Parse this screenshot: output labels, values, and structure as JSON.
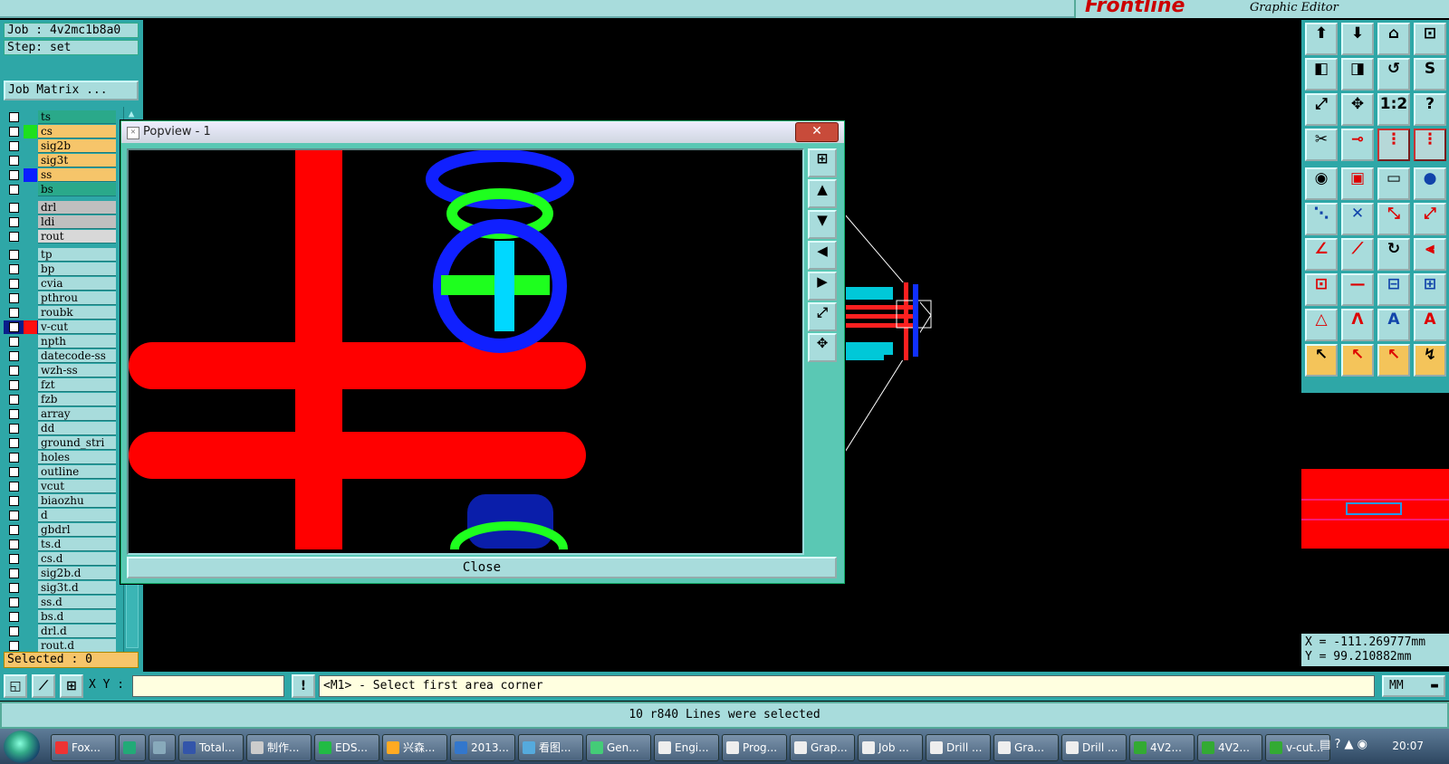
{
  "app": {
    "brand": "Frontline",
    "editor_title": "Graphic Editor"
  },
  "job": {
    "job_label": "Job : 4v2mc1b8a0",
    "step_label": "Step: set",
    "matrix_button": "Job Matrix ..."
  },
  "layers": [
    {
      "name": "ts",
      "bg": "#2aa98a",
      "swatch": ""
    },
    {
      "name": "cs",
      "bg": "#f6c56a",
      "swatch": "#1ee01e"
    },
    {
      "name": "sig2b",
      "bg": "#f6c56a",
      "swatch": ""
    },
    {
      "name": "sig3t",
      "bg": "#f6c56a",
      "swatch": ""
    },
    {
      "name": "ss",
      "bg": "#f6c56a",
      "swatch": "#0a1eff"
    },
    {
      "name": "bs",
      "bg": "#2aa98a",
      "swatch": ""
    },
    {
      "name": "drl",
      "bg": "#bfbfbf",
      "swatch": ""
    },
    {
      "name": "ldi",
      "bg": "#bfbfbf",
      "swatch": ""
    },
    {
      "name": "rout",
      "bg": "#d8d8d8",
      "swatch": ""
    },
    {
      "name": "tp",
      "bg": "#a8dcdc",
      "swatch": ""
    },
    {
      "name": "bp",
      "bg": "#a8dcdc",
      "swatch": ""
    },
    {
      "name": "cvia",
      "bg": "#a8dcdc",
      "swatch": ""
    },
    {
      "name": "pthrou",
      "bg": "#a8dcdc",
      "swatch": ""
    },
    {
      "name": "roubk",
      "bg": "#a8dcdc",
      "swatch": ""
    },
    {
      "name": "v-cut",
      "bg": "#a8dcdc",
      "swatch": "#ff1010",
      "active": true
    },
    {
      "name": "npth",
      "bg": "#a8dcdc",
      "swatch": ""
    },
    {
      "name": "datecode-ss",
      "bg": "#a8dcdc",
      "swatch": ""
    },
    {
      "name": "wzh-ss",
      "bg": "#a8dcdc",
      "swatch": ""
    },
    {
      "name": "fzt",
      "bg": "#a8dcdc",
      "swatch": ""
    },
    {
      "name": "fzb",
      "bg": "#a8dcdc",
      "swatch": ""
    },
    {
      "name": "array",
      "bg": "#a8dcdc",
      "swatch": ""
    },
    {
      "name": "dd",
      "bg": "#a8dcdc",
      "swatch": ""
    },
    {
      "name": "ground_stri",
      "bg": "#a8dcdc",
      "swatch": ""
    },
    {
      "name": "holes",
      "bg": "#a8dcdc",
      "swatch": ""
    },
    {
      "name": "outline",
      "bg": "#a8dcdc",
      "swatch": ""
    },
    {
      "name": "vcut",
      "bg": "#a8dcdc",
      "swatch": ""
    },
    {
      "name": "biaozhu",
      "bg": "#a8dcdc",
      "swatch": ""
    },
    {
      "name": "d",
      "bg": "#a8dcdc",
      "swatch": ""
    },
    {
      "name": "gbdrl",
      "bg": "#a8dcdc",
      "swatch": ""
    },
    {
      "name": "ts.d",
      "bg": "#a8dcdc",
      "swatch": ""
    },
    {
      "name": "cs.d",
      "bg": "#a8dcdc",
      "swatch": ""
    },
    {
      "name": "sig2b.d",
      "bg": "#a8dcdc",
      "swatch": ""
    },
    {
      "name": "sig3t.d",
      "bg": "#a8dcdc",
      "swatch": ""
    },
    {
      "name": "ss.d",
      "bg": "#a8dcdc",
      "swatch": ""
    },
    {
      "name": "bs.d",
      "bg": "#a8dcdc",
      "swatch": ""
    },
    {
      "name": "drl.d",
      "bg": "#a8dcdc",
      "swatch": ""
    },
    {
      "name": "rout.d",
      "bg": "#a8dcdc",
      "swatch": ""
    }
  ],
  "selected_label": "Selected : 0",
  "popview": {
    "title": "Popview - 1",
    "close_x": "✕",
    "close_button": "Close"
  },
  "coords": {
    "x": "X = -111.269777mm",
    "y": "Y = 99.210882mm"
  },
  "command": {
    "xy_label": "X Y :",
    "xy_value": "",
    "prompt": "<M1> - Select first area corner",
    "units": "MM"
  },
  "status": "10 r840 Lines were selected",
  "taskbar": {
    "items": [
      "Fox...",
      "",
      "",
      "Total...",
      "制作...",
      "EDS...",
      "兴森...",
      "2013...",
      "看图...",
      "Gen...",
      "Engi...",
      "Prog...",
      "Grap...",
      "Job ...",
      "Drill ...",
      "Gra...",
      "Drill ...",
      "4V2...",
      "4V2...",
      "v-cut..."
    ],
    "clock": "20:07"
  },
  "colors": {
    "panel": "#2ea7a7",
    "button": "#a8dcdc",
    "feature": "#ff0000",
    "accent_cyan": "#00e5ee"
  }
}
